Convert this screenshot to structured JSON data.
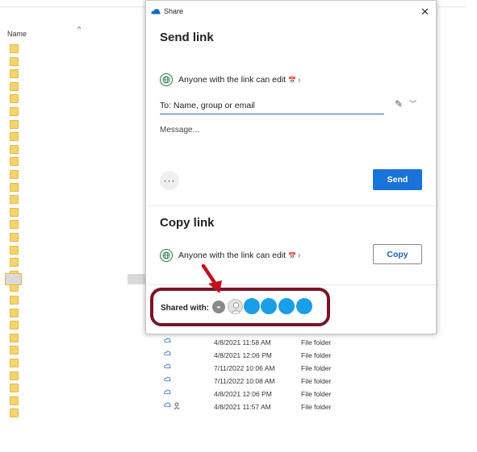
{
  "explorer": {
    "column_header": "Name",
    "rows": [
      {
        "date": "4/8/2021 11:58 AM",
        "type": "File folder",
        "shared": false
      },
      {
        "date": "4/8/2021 12:06 PM",
        "type": "File folder",
        "shared": false
      },
      {
        "date": "7/11/2022 10:06 AM",
        "type": "File folder",
        "shared": false
      },
      {
        "date": "7/11/2022 10:08 AM",
        "type": "File folder",
        "shared": false
      },
      {
        "date": "4/8/2021 12:06 PM",
        "type": "File folder",
        "shared": false
      },
      {
        "date": "4/8/2021 11:57 AM",
        "type": "File folder",
        "shared": true
      }
    ]
  },
  "dialog": {
    "title": "Share",
    "send_section": {
      "heading": "Send link",
      "permission": "Anyone with the link can edit",
      "to_placeholder": "To: Name, group or email",
      "message_placeholder": "Message...",
      "send_label": "Send"
    },
    "copy_section": {
      "heading": "Copy link",
      "permission": "Anyone with the link can edit",
      "copy_label": "Copy"
    },
    "shared_with_label": "Shared with:"
  },
  "colors": {
    "accent": "#1a73d9",
    "avatar": "#1a9ee8",
    "highlight": "#7a1428",
    "arrow": "#c0121d",
    "globe": "#1e7a3c"
  },
  "icons": [
    "onedrive-cloud-icon",
    "close-icon",
    "globe-icon",
    "calendar-icon",
    "chevron-right-icon",
    "pencil-icon",
    "chevron-down-icon",
    "more-icon",
    "link-icon",
    "person-icon",
    "sort-up-icon"
  ]
}
